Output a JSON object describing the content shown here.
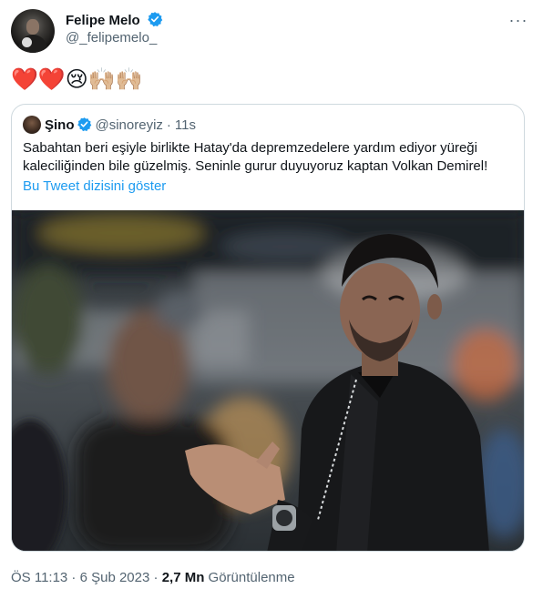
{
  "tweet": {
    "author_name": "Felipe Melo",
    "author_handle": "@_felipemelo_",
    "more_label": "···",
    "text": "❤️❤️😢🙌🏼🙌🏼",
    "verified_color": "#1d9bf0"
  },
  "quoted": {
    "author_name": "Şino",
    "author_handle": "@sinoreyiz",
    "separator": "·",
    "time": "11s",
    "text": "Sabahtan beri eşiyle birlikte Hatay'da depremzedelere yardım ediyor yüreği kaleciliğinden bile güzelmiş. Seninle gurur duyuyoruz kaptan Volkan Demirel!",
    "thread_link": "Bu Tweet dizisini göster"
  },
  "meta": {
    "timestamp": "ÖS 11:13 · 6 Şub 2023",
    "separator": "·",
    "views_count": "2,7 Mn",
    "views_label": "Görüntülenme"
  }
}
